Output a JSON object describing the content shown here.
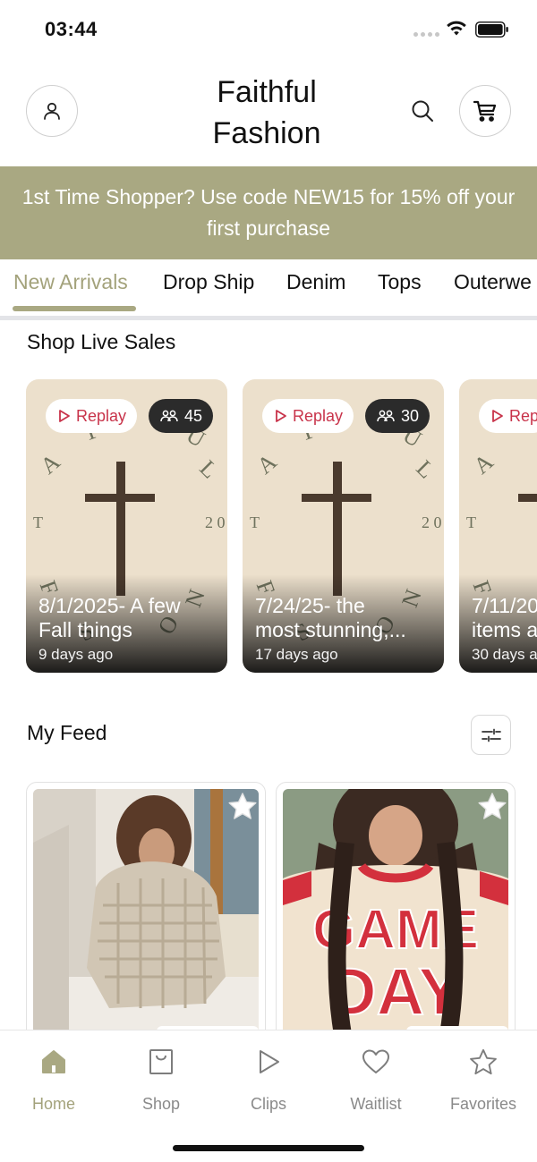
{
  "status_bar": {
    "time": "03:44"
  },
  "header": {
    "title_line1": "Faithful",
    "title_line2": "Fashion"
  },
  "promo": {
    "text": "1st Time Shopper? Use code NEW15 for 15% off your first purchase"
  },
  "tabs": [
    {
      "label": "New Arrivals",
      "active": true
    },
    {
      "label": "Drop Ship"
    },
    {
      "label": "Denim"
    },
    {
      "label": "Tops"
    },
    {
      "label": "Outerwe"
    }
  ],
  "live_sales": {
    "title": "Shop Live Sales",
    "cards": [
      {
        "replay_label": "Replay",
        "viewers": "45",
        "title_line1": "8/1/2025- A few",
        "title_line2": "Fall things",
        "age": "9 days ago"
      },
      {
        "replay_label": "Replay",
        "viewers": "30",
        "title_line1": "7/24/25- the",
        "title_line2": "most stunning,...",
        "age": "17 days ago"
      },
      {
        "replay_label": "Rep",
        "viewers": "",
        "title_line1": "7/11/20",
        "title_line2": "items a",
        "age": "30 days a"
      }
    ]
  },
  "feed": {
    "title": "My Feed"
  },
  "bottom_nav": {
    "home": "Home",
    "shop": "Shop",
    "clips": "Clips",
    "waitlist": "Waitlist",
    "favorites": "Favorites"
  },
  "colors": {
    "brand": "#a9a882",
    "brand_text": "#a3a27b",
    "replay": "#c8334a"
  }
}
